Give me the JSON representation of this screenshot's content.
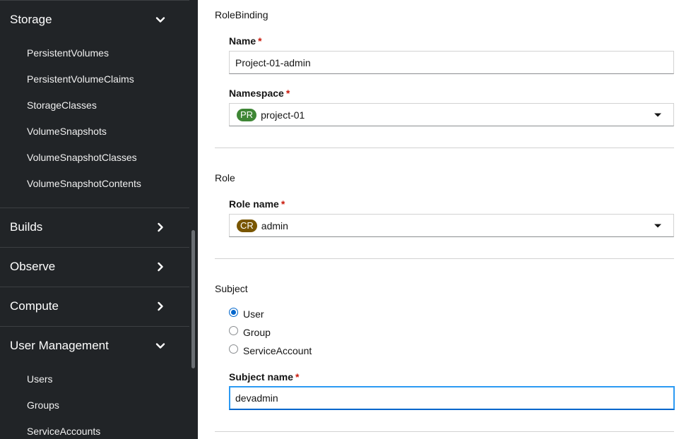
{
  "sidebar": {
    "storage": {
      "label": "Storage",
      "expanded": true,
      "items": [
        "PersistentVolumes",
        "PersistentVolumeClaims",
        "StorageClasses",
        "VolumeSnapshots",
        "VolumeSnapshotClasses",
        "VolumeSnapshotContents"
      ]
    },
    "builds": {
      "label": "Builds",
      "expanded": false
    },
    "observe": {
      "label": "Observe",
      "expanded": false
    },
    "compute": {
      "label": "Compute",
      "expanded": false
    },
    "user_management": {
      "label": "User Management",
      "expanded": true,
      "items": [
        "Users",
        "Groups",
        "ServiceAccounts"
      ]
    }
  },
  "form": {
    "rolebinding": {
      "section_title": "RoleBinding",
      "name_label": "Name",
      "name_value": "Project-01-admin",
      "namespace_label": "Namespace",
      "namespace_badge": "PR",
      "namespace_value": "project-01"
    },
    "role": {
      "section_title": "Role",
      "role_name_label": "Role name",
      "role_badge": "CR",
      "role_value": "admin"
    },
    "subject": {
      "section_title": "Subject",
      "options": [
        "User",
        "Group",
        "ServiceAccount"
      ],
      "selected": "User",
      "subject_name_label": "Subject name",
      "subject_name_value": "devadmin"
    },
    "required_marker": "*"
  },
  "colors": {
    "sidebar_bg": "#212427",
    "namespace_badge": "#3e8635",
    "role_badge": "#795600",
    "accent": "#0066cc",
    "required": "#c9190b"
  },
  "icons": {
    "expanded": "chevron-down-icon",
    "collapsed": "chevron-right-icon",
    "select_caret": "caret-down-icon"
  }
}
